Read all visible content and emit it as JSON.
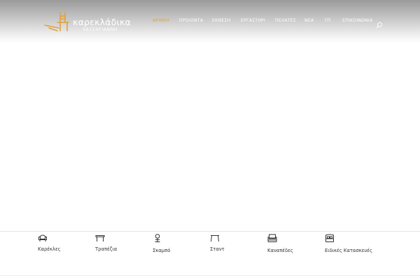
{
  "logo": {
    "name": "καρεκλάδικα",
    "subtitle": "ΧΑΤΖΗΓΙΑΝΝΗ"
  },
  "nav": {
    "items": [
      {
        "label": "ΑΡΧΙΚΗ",
        "active": true
      },
      {
        "label": "ΠΡΟΙΟΝΤΑ",
        "active": false
      },
      {
        "label": "ΕΚΘΕΣΗ",
        "active": false
      },
      {
        "label": "ΕΡΓΑΣΤΗΡΙ",
        "active": false
      },
      {
        "label": "ΠΕΛΑΤΕΣ",
        "active": false
      },
      {
        "label": "ΝΕΑ",
        "active": false
      },
      {
        "label": "ΓΠ",
        "active": false
      },
      {
        "label": "ΕΠΙΚΟΙΝΩΝΙΑ",
        "active": false
      }
    ],
    "search_icon": "search-icon",
    "active_color": "#e0a23c"
  },
  "categories": [
    {
      "label": "Καρέκλες",
      "icon": "armchair-icon"
    },
    {
      "label": "Τραπέζια",
      "icon": "table-icon"
    },
    {
      "label": "Σκαμπό",
      "icon": "stool-icon"
    },
    {
      "label": "Σταντ",
      "icon": "stand-icon"
    },
    {
      "label": "Καναπέδες",
      "icon": "sofa-icon"
    },
    {
      "label": "Ειδικές Κατασκευές",
      "icon": "bed-icon"
    }
  ]
}
